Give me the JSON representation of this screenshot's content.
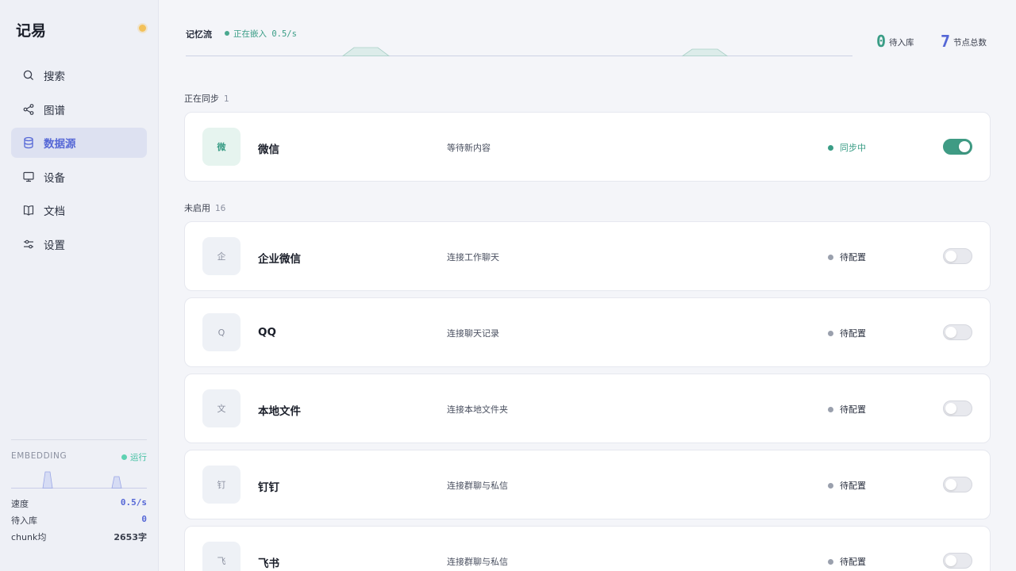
{
  "app": {
    "title": "记易"
  },
  "nav": {
    "items": [
      {
        "label": "搜索",
        "icon": "search-icon"
      },
      {
        "label": "图谱",
        "icon": "share-icon"
      },
      {
        "label": "数据源",
        "icon": "database-icon",
        "active": true
      },
      {
        "label": "设备",
        "icon": "monitor-icon"
      },
      {
        "label": "文档",
        "icon": "book-icon"
      },
      {
        "label": "设置",
        "icon": "sliders-icon"
      }
    ]
  },
  "embedding": {
    "title": "EMBEDDING",
    "status": "运行",
    "rows": [
      {
        "label": "速度",
        "value": "0.5/s"
      },
      {
        "label": "待入库",
        "value": "0"
      },
      {
        "label": "chunk均",
        "value": "2653字"
      }
    ]
  },
  "stream": {
    "title": "记忆流",
    "status": "正在嵌入 0.5/s"
  },
  "stats": {
    "pending": {
      "value": "0",
      "label": "待入库"
    },
    "total": {
      "value": "7",
      "label": "节点总数"
    }
  },
  "sections": {
    "syncing": {
      "label": "正在同步",
      "count": "1"
    },
    "disabled": {
      "label": "未启用",
      "count": "16"
    }
  },
  "sources": [
    {
      "avatar": "微",
      "name": "微信",
      "desc": "等待新内容",
      "status": "同步中",
      "enabled": true
    },
    {
      "avatar": "企",
      "name": "企业微信",
      "desc": "连接工作聊天",
      "status": "待配置",
      "enabled": false
    },
    {
      "avatar": "Q",
      "name": "QQ",
      "desc": "连接聊天记录",
      "status": "待配置",
      "enabled": false
    },
    {
      "avatar": "文",
      "name": "本地文件",
      "desc": "连接本地文件夹",
      "status": "待配置",
      "enabled": false
    },
    {
      "avatar": "钉",
      "name": "钉钉",
      "desc": "连接群聊与私信",
      "status": "待配置",
      "enabled": false
    },
    {
      "avatar": "飞",
      "name": "飞书",
      "desc": "连接群聊与私信",
      "status": "待配置",
      "enabled": false
    }
  ],
  "colors": {
    "accent": "#5567d6",
    "success": "#3a9d86",
    "muted": "#9aa0ad"
  }
}
